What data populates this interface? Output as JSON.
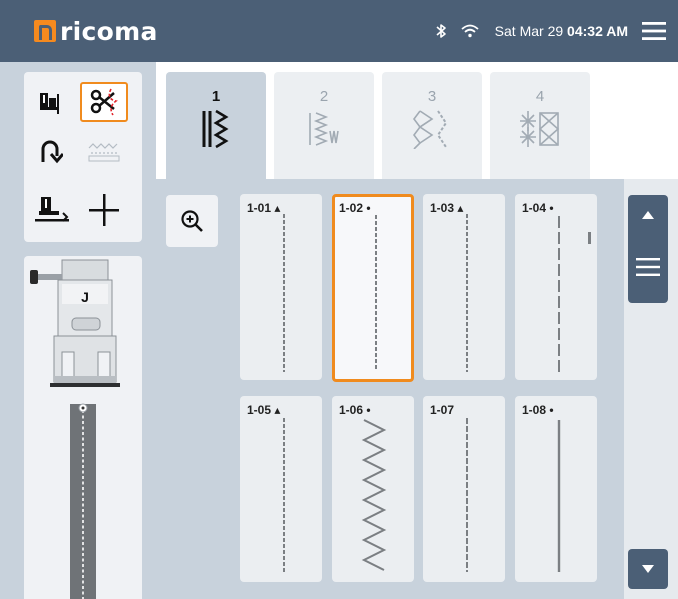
{
  "brand": {
    "name": "ricoma",
    "accent": "#f58a1f",
    "bar_color": "#4b5f76"
  },
  "status": {
    "date": "Sat Mar 29",
    "time": "04:32 AM",
    "icons": [
      "bluetooth-icon",
      "wifi-icon",
      "hamburger-menu-icon"
    ]
  },
  "tools": [
    {
      "name": "needle-up-down-icon",
      "selected": false
    },
    {
      "name": "thread-cutter-icon",
      "selected": true
    },
    {
      "name": "reverse-stitch-icon",
      "selected": false
    },
    {
      "name": "lock-stitch-icon",
      "selected": false,
      "disabled": true
    },
    {
      "name": "presser-foot-icon",
      "selected": false
    },
    {
      "name": "needle-position-icon",
      "selected": false
    }
  ],
  "presser_foot": {
    "label": "J"
  },
  "tabs": [
    {
      "label": "1",
      "active": true
    },
    {
      "label": "2",
      "active": false
    },
    {
      "label": "3",
      "active": false
    },
    {
      "label": "4",
      "active": false
    }
  ],
  "zoom": {
    "icon": "zoom-in-icon"
  },
  "stitches": [
    {
      "label": "1-01 ▴",
      "selected": false
    },
    {
      "label": "1-02 •",
      "selected": true
    },
    {
      "label": "1-03 ▴",
      "selected": false
    },
    {
      "label": "1-04 •",
      "selected": false
    },
    {
      "label": "1-05 ▴",
      "selected": false
    },
    {
      "label": "1-06 •",
      "selected": false
    },
    {
      "label": "1-07",
      "selected": false
    },
    {
      "label": "1-08 •",
      "selected": false
    }
  ],
  "scroll": {
    "up_icon": "scroll-up-icon",
    "down_icon": "scroll-down-icon",
    "thumb_icon": "scroll-thumb-icon"
  }
}
